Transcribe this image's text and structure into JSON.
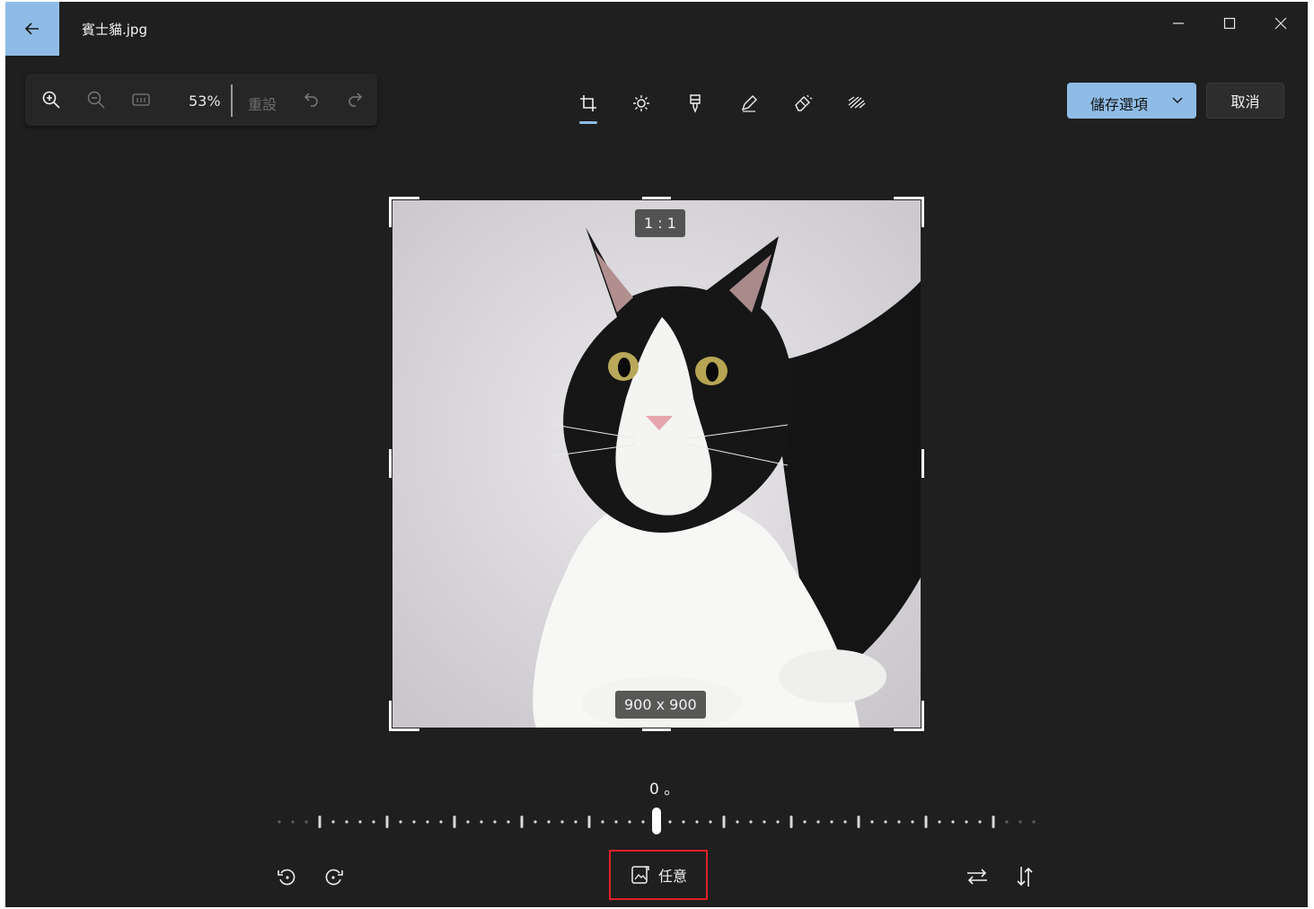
{
  "window": {
    "title": "賓士貓.jpg"
  },
  "toolbar": {
    "zoom_percent": "53%",
    "reset_label": "重設"
  },
  "actions": {
    "save_label": "儲存選項",
    "cancel_label": "取消"
  },
  "crop": {
    "aspect_badge": "1 : 1",
    "size_badge": "900 x 900"
  },
  "rotation": {
    "angle_label": "0 。",
    "value": 0
  },
  "aspect_selector": {
    "label": "任意"
  },
  "colors": {
    "accent": "#8fbce6",
    "background": "#1f1f1f",
    "highlight_box": "#e0202a"
  },
  "icons": {
    "back": "arrow-left-icon",
    "zoom_in": "zoom-in-icon",
    "zoom_out": "zoom-out-icon",
    "actual_size": "actual-size-icon",
    "undo": "undo-icon",
    "redo": "redo-icon",
    "crop": "crop-icon",
    "adjust": "brightness-icon",
    "filter": "filter-icon",
    "markup": "pen-icon",
    "erase": "eraser-icon",
    "background": "background-blur-icon",
    "rotate_left": "rotate-left-icon",
    "rotate_right": "rotate-right-icon",
    "flip_horizontal": "flip-horizontal-icon",
    "flip_vertical": "flip-vertical-icon",
    "aspect": "aspect-ratio-icon"
  }
}
